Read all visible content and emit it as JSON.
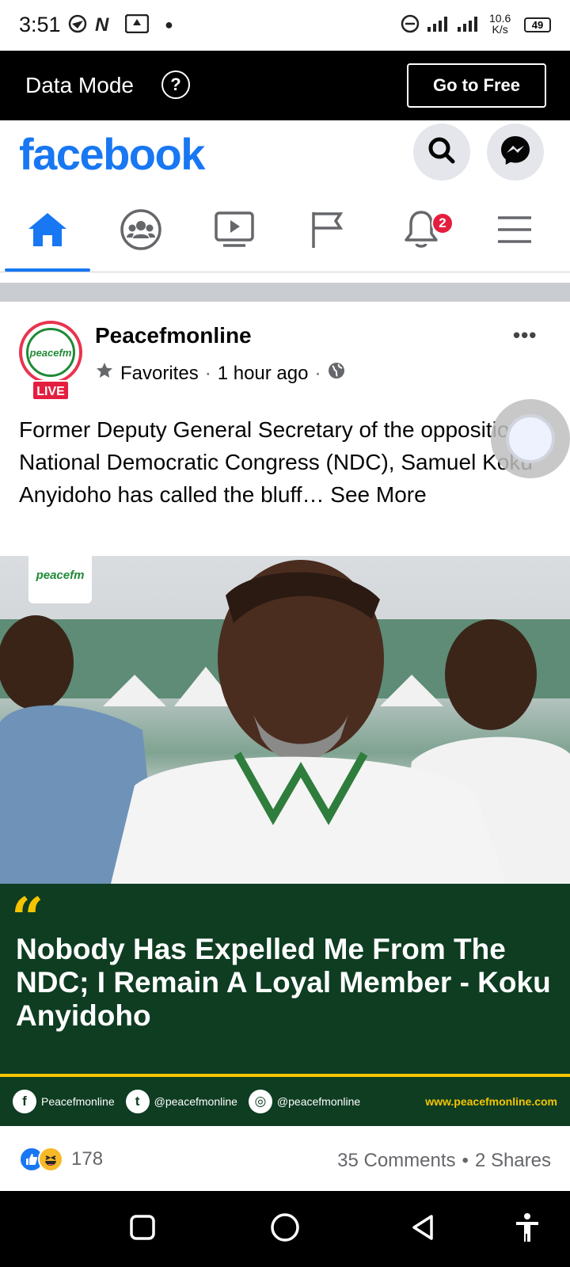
{
  "status_bar": {
    "time": "3:51",
    "speed_value": "10.6",
    "speed_unit": "K/s",
    "battery": "49"
  },
  "data_mode": {
    "title": "Data Mode",
    "help_symbol": "?",
    "go_free_label": "Go to Free"
  },
  "header": {
    "logo": "facebook",
    "search_icon": "search-icon",
    "messenger_icon": "messenger-icon"
  },
  "nav": {
    "tabs": [
      {
        "name": "home",
        "icon": "home-icon",
        "active": true
      },
      {
        "name": "groups",
        "icon": "groups-icon"
      },
      {
        "name": "watch",
        "icon": "video-icon"
      },
      {
        "name": "pages",
        "icon": "flag-icon"
      },
      {
        "name": "notifications",
        "icon": "bell-icon",
        "badge": "2"
      },
      {
        "name": "menu",
        "icon": "hamburger-icon"
      }
    ],
    "accent_color": "#1877f2"
  },
  "post": {
    "page_name": "Peacefmonline",
    "avatar_text": "peacefm",
    "live_label": "LIVE",
    "meta_favorites": "Favorites",
    "meta_dot": "·",
    "meta_time": "1 hour ago",
    "meta_dot2": "·",
    "more_label": "•••",
    "text": "Former Deputy General Secretary of the opposition National Democratic Congress (NDC), Samuel Koku Anyidoho has called the bluff…",
    "see_more": " See More",
    "image": {
      "logo_text": "peacefm",
      "quote_mark": "“",
      "headline": "Nobody Has Expelled Me From The NDC; I Remain A Loyal Member - Koku Anyidoho",
      "social": [
        {
          "icon": "facebook-icon",
          "glyph": "f",
          "handle": "Peacefmonline"
        },
        {
          "icon": "twitter-icon",
          "glyph": "t",
          "handle": "@peacefmonline"
        },
        {
          "icon": "instagram-icon",
          "glyph": "◎",
          "handle": "@peacefmonline"
        }
      ],
      "url": "www.peacefmonline.com",
      "panel_color": "#0e3d22",
      "accent_color": "#f5c400"
    },
    "reactions": {
      "like_icon": "like-icon",
      "haha_icon": "haha-icon",
      "count": "178"
    },
    "comments": "35 Comments",
    "separator": "•",
    "shares": "2 Shares"
  }
}
